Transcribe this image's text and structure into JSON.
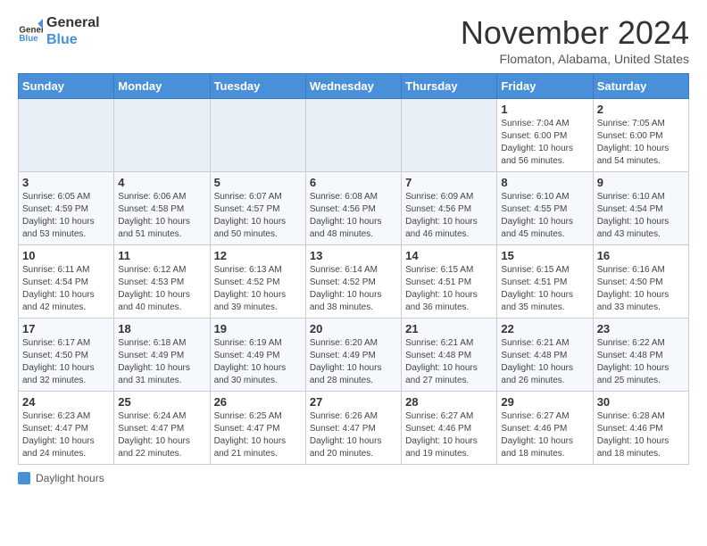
{
  "header": {
    "logo_line1": "General",
    "logo_line2": "Blue",
    "month": "November 2024",
    "location": "Flomaton, Alabama, United States"
  },
  "days_of_week": [
    "Sunday",
    "Monday",
    "Tuesday",
    "Wednesday",
    "Thursday",
    "Friday",
    "Saturday"
  ],
  "weeks": [
    [
      {
        "day": "",
        "info": ""
      },
      {
        "day": "",
        "info": ""
      },
      {
        "day": "",
        "info": ""
      },
      {
        "day": "",
        "info": ""
      },
      {
        "day": "",
        "info": ""
      },
      {
        "day": "1",
        "info": "Sunrise: 7:04 AM\nSunset: 6:00 PM\nDaylight: 10 hours and 56 minutes."
      },
      {
        "day": "2",
        "info": "Sunrise: 7:05 AM\nSunset: 6:00 PM\nDaylight: 10 hours and 54 minutes."
      }
    ],
    [
      {
        "day": "3",
        "info": "Sunrise: 6:05 AM\nSunset: 4:59 PM\nDaylight: 10 hours and 53 minutes."
      },
      {
        "day": "4",
        "info": "Sunrise: 6:06 AM\nSunset: 4:58 PM\nDaylight: 10 hours and 51 minutes."
      },
      {
        "day": "5",
        "info": "Sunrise: 6:07 AM\nSunset: 4:57 PM\nDaylight: 10 hours and 50 minutes."
      },
      {
        "day": "6",
        "info": "Sunrise: 6:08 AM\nSunset: 4:56 PM\nDaylight: 10 hours and 48 minutes."
      },
      {
        "day": "7",
        "info": "Sunrise: 6:09 AM\nSunset: 4:56 PM\nDaylight: 10 hours and 46 minutes."
      },
      {
        "day": "8",
        "info": "Sunrise: 6:10 AM\nSunset: 4:55 PM\nDaylight: 10 hours and 45 minutes."
      },
      {
        "day": "9",
        "info": "Sunrise: 6:10 AM\nSunset: 4:54 PM\nDaylight: 10 hours and 43 minutes."
      }
    ],
    [
      {
        "day": "10",
        "info": "Sunrise: 6:11 AM\nSunset: 4:54 PM\nDaylight: 10 hours and 42 minutes."
      },
      {
        "day": "11",
        "info": "Sunrise: 6:12 AM\nSunset: 4:53 PM\nDaylight: 10 hours and 40 minutes."
      },
      {
        "day": "12",
        "info": "Sunrise: 6:13 AM\nSunset: 4:52 PM\nDaylight: 10 hours and 39 minutes."
      },
      {
        "day": "13",
        "info": "Sunrise: 6:14 AM\nSunset: 4:52 PM\nDaylight: 10 hours and 38 minutes."
      },
      {
        "day": "14",
        "info": "Sunrise: 6:15 AM\nSunset: 4:51 PM\nDaylight: 10 hours and 36 minutes."
      },
      {
        "day": "15",
        "info": "Sunrise: 6:15 AM\nSunset: 4:51 PM\nDaylight: 10 hours and 35 minutes."
      },
      {
        "day": "16",
        "info": "Sunrise: 6:16 AM\nSunset: 4:50 PM\nDaylight: 10 hours and 33 minutes."
      }
    ],
    [
      {
        "day": "17",
        "info": "Sunrise: 6:17 AM\nSunset: 4:50 PM\nDaylight: 10 hours and 32 minutes."
      },
      {
        "day": "18",
        "info": "Sunrise: 6:18 AM\nSunset: 4:49 PM\nDaylight: 10 hours and 31 minutes."
      },
      {
        "day": "19",
        "info": "Sunrise: 6:19 AM\nSunset: 4:49 PM\nDaylight: 10 hours and 30 minutes."
      },
      {
        "day": "20",
        "info": "Sunrise: 6:20 AM\nSunset: 4:49 PM\nDaylight: 10 hours and 28 minutes."
      },
      {
        "day": "21",
        "info": "Sunrise: 6:21 AM\nSunset: 4:48 PM\nDaylight: 10 hours and 27 minutes."
      },
      {
        "day": "22",
        "info": "Sunrise: 6:21 AM\nSunset: 4:48 PM\nDaylight: 10 hours and 26 minutes."
      },
      {
        "day": "23",
        "info": "Sunrise: 6:22 AM\nSunset: 4:48 PM\nDaylight: 10 hours and 25 minutes."
      }
    ],
    [
      {
        "day": "24",
        "info": "Sunrise: 6:23 AM\nSunset: 4:47 PM\nDaylight: 10 hours and 24 minutes."
      },
      {
        "day": "25",
        "info": "Sunrise: 6:24 AM\nSunset: 4:47 PM\nDaylight: 10 hours and 22 minutes."
      },
      {
        "day": "26",
        "info": "Sunrise: 6:25 AM\nSunset: 4:47 PM\nDaylight: 10 hours and 21 minutes."
      },
      {
        "day": "27",
        "info": "Sunrise: 6:26 AM\nSunset: 4:47 PM\nDaylight: 10 hours and 20 minutes."
      },
      {
        "day": "28",
        "info": "Sunrise: 6:27 AM\nSunset: 4:46 PM\nDaylight: 10 hours and 19 minutes."
      },
      {
        "day": "29",
        "info": "Sunrise: 6:27 AM\nSunset: 4:46 PM\nDaylight: 10 hours and 18 minutes."
      },
      {
        "day": "30",
        "info": "Sunrise: 6:28 AM\nSunset: 4:46 PM\nDaylight: 10 hours and 18 minutes."
      }
    ]
  ],
  "legend": {
    "label": "Daylight hours"
  }
}
